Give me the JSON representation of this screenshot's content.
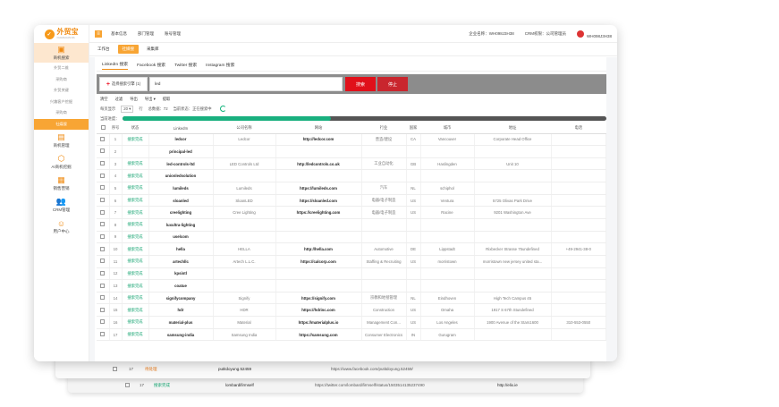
{
  "app": {
    "name": "外贸宝",
    "tagline": "CHAIGUANJIA"
  },
  "colors": {
    "accent": "#f8a534",
    "danger": "#e0101a",
    "success": "#19b07f"
  },
  "sidebar": {
    "sections": [
      {
        "label": "商机搜索",
        "icon": "search-icon",
        "active": true
      },
      {
        "label": "商机管理",
        "icon": "briefcase-icon"
      },
      {
        "label": "AI商机挖掘",
        "icon": "hexagon-icon"
      },
      {
        "label": "销售营销",
        "icon": "chart-icon"
      },
      {
        "label": "CRM管理",
        "icon": "users-icon"
      },
      {
        "label": "用户中心",
        "icon": "user-icon"
      }
    ],
    "items": [
      "外贸二维",
      "采购商",
      "外贸关键",
      "兴趣客户挖掘",
      "采购商",
      "社媒搜"
    ]
  },
  "topbar": {
    "nav": [
      "基本信息",
      "部门管理",
      "账号管理"
    ],
    "company_label": "企业名称：WH098J3H38",
    "crm_label": "CRM权限：公司管理员",
    "user": "WH098J3H38"
  },
  "tabs": {
    "workbench": "工作台",
    "active": "社媒搜",
    "other": "采集库"
  },
  "subtabs": [
    "LinkedIn 搜索",
    "Facebook 搜索",
    "Twitter 搜索",
    "Instagram 搜索"
  ],
  "search": {
    "select_label": "选择搜索引擎 (1)",
    "query": "led",
    "search_button": "搜索",
    "stop_button": "停止"
  },
  "toolbar": [
    "清空",
    "过滤",
    "导出",
    "导出",
    "提取"
  ],
  "info": {
    "per_page_label": "每页显示",
    "per_page": "20",
    "per_page_unit": "行",
    "total": "总数据：72",
    "status": "当前状态：正在搜索中"
  },
  "progress": {
    "label": "当前进度：",
    "value": 0.43
  },
  "table": {
    "headers": [
      "",
      "序号",
      "状态",
      "LinkedIn",
      "公司名称",
      "网站",
      "行业",
      "国家",
      "城市",
      "地址",
      "电话"
    ],
    "rows": [
      [
        "1",
        "搜索完成",
        "ledcor",
        "Ledcor",
        "http://ledcor.com",
        "营造/建设",
        "CA",
        "Vancouver",
        "Corporate Head Office",
        ""
      ],
      [
        "2",
        "",
        "principal-led",
        "",
        "",
        "",
        "",
        "",
        "",
        ""
      ],
      [
        "3",
        "搜索完成",
        "led-controls-ltd",
        "LED Controls Ltd",
        "http://ledcontrols.co.uk",
        "工业自动化",
        "GB",
        "Haslingden",
        "Unit 10",
        ""
      ],
      [
        "4",
        "搜索完成",
        "unionledsolution",
        "",
        "",
        "",
        "",
        "",
        "",
        ""
      ],
      [
        "5",
        "搜索完成",
        "lumileds",
        "Lumileds",
        "https://lumileds.com",
        "汽车",
        "NL",
        "schiphol",
        "",
        ""
      ],
      [
        "6",
        "搜索完成",
        "sloanled",
        "SloanLED",
        "https://sloanled.com",
        "电器/电子制造",
        "US",
        "Ventura",
        "5725 Olivas Park Drive",
        ""
      ],
      [
        "7",
        "搜索完成",
        "creelighting",
        "Cree Lighting",
        "https://creelighting.com",
        "电器/电子制造",
        "US",
        "Racine",
        "9201 Washington Ave",
        ""
      ],
      [
        "8",
        "搜索完成",
        "luxultra-lighting",
        "",
        "",
        "",
        "",
        "",
        "",
        ""
      ],
      [
        "9",
        "搜索完成",
        "uselcom",
        "",
        "",
        "",
        "",
        "",
        "",
        ""
      ],
      [
        "10",
        "搜索完成",
        "hella",
        "HELLA",
        "http://hella.com",
        "Automotive",
        "DE",
        "Lippstadt",
        "Rixbecker Strasse 75undefined",
        "+49-2941-38-0"
      ],
      [
        "11",
        "搜索完成",
        "artechllc",
        "Artech L.L.C.",
        "https://calcorp.com",
        "Staffing & Recruiting",
        "US",
        "morristown",
        "morristown new jersey united sta...",
        ""
      ],
      [
        "12",
        "搜索完成",
        "kpsintl",
        "",
        "",
        "",
        "",
        "",
        "",
        ""
      ],
      [
        "13",
        "搜索完成",
        "coatue",
        "",
        "",
        "",
        "",
        "",
        "",
        ""
      ],
      [
        "14",
        "搜索完成",
        "signifycompany",
        "Signify",
        "https://signify.com",
        "宗教和地毯管理",
        "NL",
        "Eindhoven",
        "High Tech Campus 45",
        ""
      ],
      [
        "15",
        "搜索完成",
        "hdr",
        "HDR",
        "https://hdrinc.com",
        "Construction",
        "US",
        "Omaha",
        "1917 S 67th Stundefined",
        ""
      ],
      [
        "16",
        "搜索完成",
        "material-plus",
        "Material",
        "https://materialplus.io",
        "Management Con...",
        "US",
        "Los Angeles",
        "1900 Avenue of the Stars1600",
        "310-553-0550"
      ],
      [
        "17",
        "搜索完成",
        "samsung-india",
        "Samsung India",
        "https://samsung.com",
        "Consumer Electronics",
        "IN",
        "Gurugram",
        "",
        ""
      ]
    ]
  },
  "ghost_rows": [
    {
      "index": "17",
      "status": "待处理",
      "linkedin": "putitdoyung.52459",
      "url": "https://www.facebook.com/putitdoyung.52459/"
    },
    {
      "index": "17",
      "status": "搜索完成",
      "linkedin": "lombardifirmself",
      "url": "https://twitter.com/lombardifirmself/status/1503514135237490",
      "site": "http://elix.ie"
    }
  ]
}
